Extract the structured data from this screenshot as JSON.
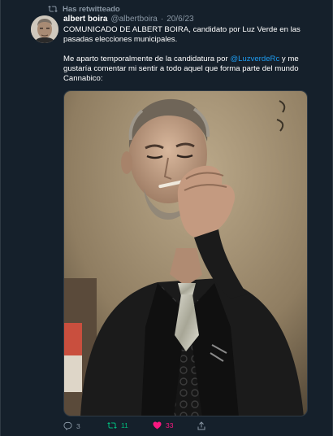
{
  "retweet_indicator": {
    "label": "Has retwitteado",
    "icon": "retweet-icon"
  },
  "tweet": {
    "author": {
      "display_name": "albert boira",
      "handle": "@albertboira",
      "separator": "·",
      "date": "20/6/23"
    },
    "paragraph_1": "COMUNICADO DE ALBERT BOIRA, candidato por Luz Verde en las pasadas elecciones municipales.",
    "paragraph_2_before": "Me aparto temporalmente de la candidatura por ",
    "paragraph_2_mention": "@LuzverdeRc",
    "paragraph_2_after": " y me gustaría comentar mi sentir a todo aquel que forma parte del mundo Cannabico:",
    "media": {
      "kind": "photo"
    },
    "actions": {
      "reply_count": "3",
      "retweet_count": "11",
      "like_count": "33"
    }
  },
  "colors": {
    "background": "#15202b",
    "secondary_text": "#8b98a5",
    "link": "#1d9bf0",
    "retweet_active": "#00ba7c",
    "like_active": "#f91880"
  }
}
